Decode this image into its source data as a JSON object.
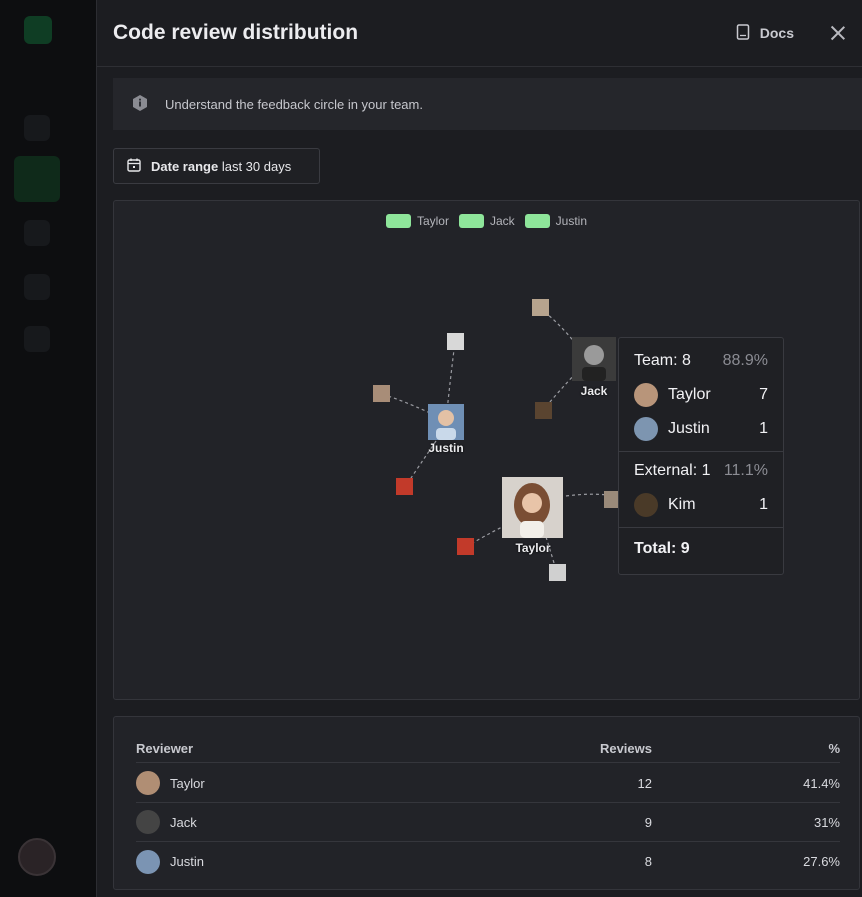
{
  "header": {
    "title": "Code review distribution",
    "docs_label": "Docs"
  },
  "info": {
    "text": "Understand the feedback circle in your team."
  },
  "date_range": {
    "label": "Date range",
    "value": "last 30 days"
  },
  "legend": [
    "Taylor",
    "Jack",
    "Justin"
  ],
  "graph": {
    "nodes": [
      {
        "name": "Justin",
        "color": "#6f8fb5"
      },
      {
        "name": "Jack",
        "color": "#3b3b3b"
      },
      {
        "name": "Taylor",
        "color": "#c6a487"
      }
    ],
    "legend_color": "#8ee59a"
  },
  "tooltip": {
    "team_label": "Team: 8",
    "team_pct": "88.9%",
    "team_rows": [
      {
        "name": "Taylor",
        "count": "7",
        "color": "#b8957a"
      },
      {
        "name": "Justin",
        "count": "1",
        "color": "#7d95b0"
      }
    ],
    "external_label": "External: 1",
    "external_pct": "11.1%",
    "external_rows": [
      {
        "name": "Kim",
        "count": "1",
        "color": "#4a3a28"
      }
    ],
    "total_label": "Total: 9"
  },
  "table": {
    "headers": {
      "reviewer": "Reviewer",
      "reviews": "Reviews",
      "pct": "%"
    },
    "rows": [
      {
        "name": "Taylor",
        "reviews": "12",
        "pct": "41.4%",
        "color": "#b08e74"
      },
      {
        "name": "Jack",
        "reviews": "9",
        "pct": "31%",
        "color": "#444444"
      },
      {
        "name": "Justin",
        "reviews": "8",
        "pct": "27.6%",
        "color": "#7b94b3"
      }
    ]
  }
}
